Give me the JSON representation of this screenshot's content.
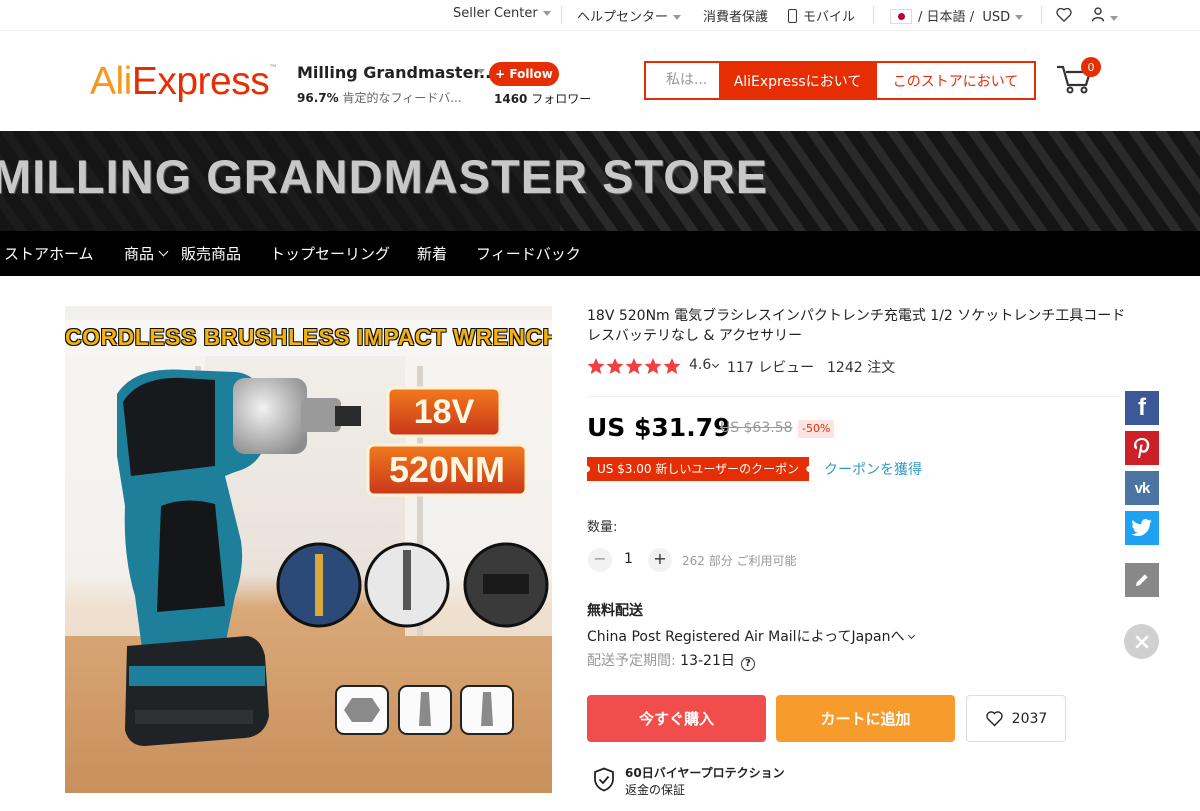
{
  "topbar": {
    "seller_center": "Seller Center",
    "help_center": "ヘルプセンター",
    "consumer_protection": "消費者保護",
    "mobile": "モバイル",
    "locale_sep1": "/",
    "language": "日本語",
    "locale_sep2": "/",
    "currency": "USD"
  },
  "header": {
    "logo_text_a": "Ali",
    "logo_text_b": "Express",
    "logo_tm": "™",
    "store_name": "Milling Grandmaster...",
    "feedback_percent": "96.7%",
    "feedback_label": "肯定的なフィードバ...",
    "follow_label": "+ Follow",
    "followers_count": "1460",
    "followers_label": "フォロワー",
    "search_placeholder": "私は...",
    "search_all_label": "AliExpressにおいて",
    "search_store_label": "このストアにおいて",
    "cart_count": "0"
  },
  "banner": {
    "title": "MILLING GRANDMASTER STORE"
  },
  "store_nav": {
    "items": [
      {
        "label": "ストアホーム"
      },
      {
        "label": "商品"
      },
      {
        "label": "販売商品"
      },
      {
        "label": "トップセーリング"
      },
      {
        "label": "新着"
      },
      {
        "label": "フィードバック"
      }
    ]
  },
  "product_image": {
    "headline": "CORDLESS BRUSHLESS IMPACT WRENCH",
    "badge_voltage": "18V",
    "badge_torque": "520NM"
  },
  "product": {
    "title": "18V 520Nm 電気ブラシレスインパクトレンチ充電式 1/2 ソケットレンチ工具コードレスバッテリなし & アクセサリー",
    "rating_value": "4.6",
    "rating_stars": 4.6,
    "reviews": "117 レビュー",
    "orders": "1242 注文",
    "price": "US $31.79",
    "old_price": "US $63.58",
    "discount": "-50%",
    "coupon": "US $3.00 新しいユーザーのクーポン",
    "get_coupon": "クーポンを獲得",
    "quantity_label": "数量:",
    "quantity_minus": "−",
    "quantity_value": "1",
    "quantity_plus": "+",
    "available": "262 部分 ご利用可能",
    "shipping_title": "無料配送",
    "shipping_method": "China Post Registered Air MailによってJapanへ",
    "delivery_label": "配送予定期間:",
    "delivery_value": "13-21日",
    "buy_now": "今すぐ購入",
    "add_to_cart": "カートに追加",
    "wishlist_count": "2037",
    "protection_title": "60日バイヤープロテクション",
    "protection_sub": "返金の保証"
  },
  "colors": {
    "brand_red": "#e62e04",
    "buy_red": "#f24d4d",
    "cart_orange": "#f89b2d",
    "link_blue": "#2e9cc3",
    "star": "#f23f3f"
  },
  "share": {
    "facebook": "f",
    "vk": "vk"
  }
}
